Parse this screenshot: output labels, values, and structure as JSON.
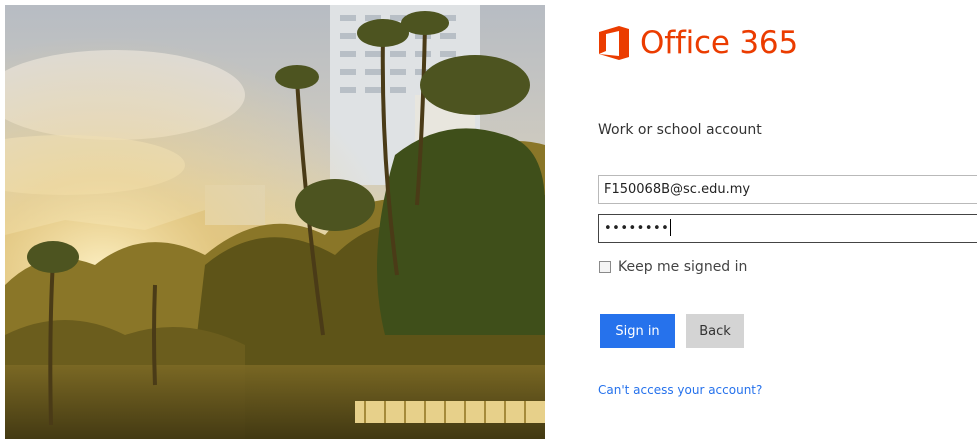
{
  "brand": {
    "name": "Office 365",
    "color": "#eb3c00",
    "logo_icon": "office-logo-icon"
  },
  "hero": {
    "icon": "palm-trees-photo"
  },
  "signin": {
    "account_label": "Work or school account",
    "email_value": "F150068B@sc.edu.my",
    "password_mask": "••••••••",
    "keep_signed_in_label": "Keep me signed in",
    "keep_signed_in_checked": false,
    "signin_button": "Sign in",
    "back_button": "Back",
    "help_link": "Can't access your account?",
    "accent_color": "#2672ec"
  }
}
